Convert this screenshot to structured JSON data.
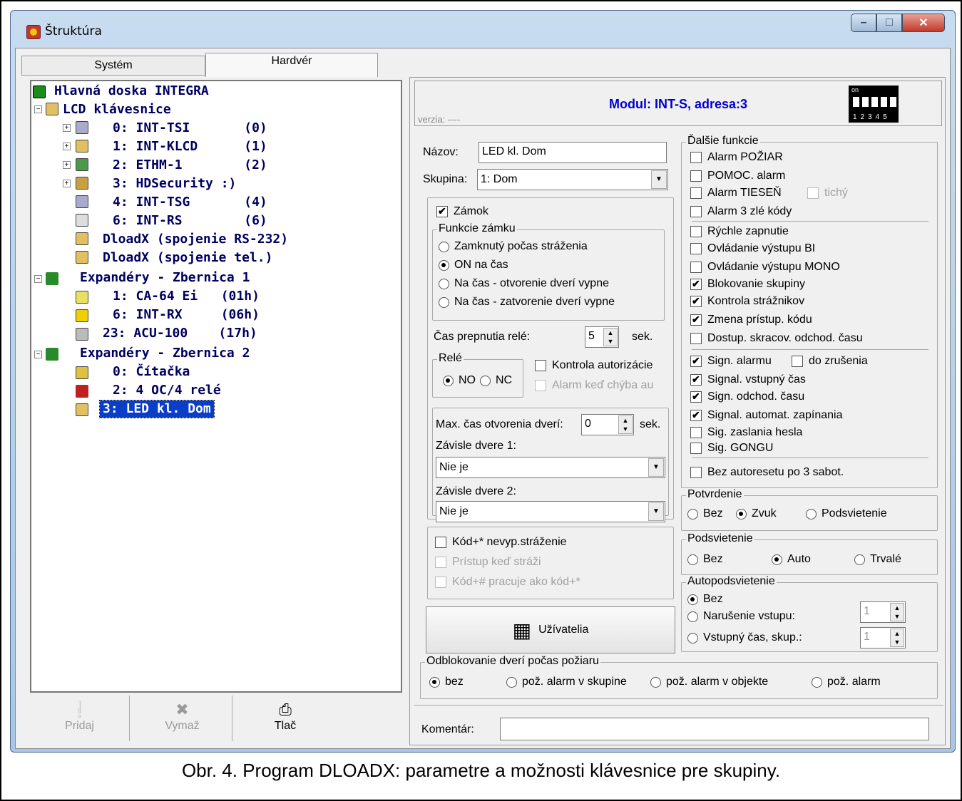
{
  "window": {
    "title": "Štruktúra",
    "min_label": "–",
    "max_label": "□",
    "close_label": "✕"
  },
  "tabs": [
    "Systém",
    "Hardvér"
  ],
  "tree": {
    "items": [
      "Hlavná doska INTEGRA",
      "LCD klávesnice",
      "0: INT-TSI       (0)",
      "1: INT-KLCD      (1)",
      "2: ETHM-1        (2)",
      "3: HDSecurity :)",
      "4: INT-TSG       (4)",
      "6: INT-RS        (6)",
      "DloadX (spojenie RS-232)",
      "DloadX (spojenie tel.)",
      "Expandéry - Zbernica 1",
      "1: CA-64 Ei   (01h)",
      "6: INT-RX     (06h)",
      "23: ACU-100    (17h)",
      "Expandéry - Zbernica 2",
      "0: Čítačka",
      "2: 4 OC/4 relé",
      "3: LED kl. Dom"
    ]
  },
  "toolbar": {
    "add": "Pridaj",
    "delete": "Vymaž",
    "print": "Tlač"
  },
  "module": {
    "title": "Modul: INT-S, adresa:3",
    "version": "verzia: ----",
    "dip_on": "on",
    "dip_nums": "12345"
  },
  "form": {
    "name_label": "Názov:",
    "name_value": "LED kl. Dom",
    "group_label": "Skupina:",
    "group_value": "1: Dom",
    "lock": "Zámok",
    "lock_functions": "Funkcie zámku",
    "lock_opts": [
      "Zamknutý počas stráženia",
      "ON na čas",
      "Na čas - otvorenie dverí vypne",
      "Na čas - zatvorenie dverí vypne"
    ],
    "relay_time_label": "Čas prepnutia relé:",
    "relay_time_value": "5",
    "sek": "sek.",
    "relay": "Relé",
    "no": "NO",
    "nc": "NC",
    "auth_control": "Kontrola autorizácie",
    "alarm_missing": "Alarm keď chýba au",
    "max_door_label": "Max. čas otvorenia dverí:",
    "max_door_value": "0",
    "dep_door1_label": "Závisle dvere 1:",
    "dep_door1_value": "Nie je",
    "dep_door2_label": "Závisle dvere 2:",
    "dep_door2_value": "Nie je",
    "code_star": "Kód+* nevyp.stráženie",
    "access_armed": "Prístup keď stráži",
    "code_hash": "Kód+# pracuje ako kód+*",
    "users_btn": "Užívatelia"
  },
  "more": {
    "title": "Ďalšie funkcie",
    "items": [
      "Alarm POŽIAR",
      "POMOC. alarm",
      "Alarm TIESEŇ",
      "Alarm 3 zlé kódy",
      "Rýchle zapnutie",
      "Ovládanie výstupu BI",
      "Ovládanie výstupu MONO",
      "Blokovanie skupiny",
      "Kontrola strážnikov",
      "Zmena prístup. kódu",
      "Dostup. skracov. odchod. času",
      "Sign. alarmu",
      "Signal. vstupný čas",
      "Sign. odchod. času",
      "Signal. automat. zapínania",
      "Sig. zaslania hesla",
      "Sig. GONGU",
      "Bez autoresetu po 3 sabot."
    ],
    "silent": "tichý",
    "until_cancel": "do zrušenia"
  },
  "confirm": {
    "title": "Potvrdenie",
    "opts": [
      "Bez",
      "Zvuk",
      "Podsvietenie"
    ]
  },
  "backlight": {
    "title": "Podsvietenie",
    "opts": [
      "Bez",
      "Auto",
      "Trvalé"
    ]
  },
  "autobacklight": {
    "title": "Autopodsvietenie",
    "opts": [
      "Bez",
      "Narušenie vstupu:",
      "Vstupný čas, skup.:"
    ],
    "v1": "1",
    "v2": "1"
  },
  "fire": {
    "title": "Odblokovanie dverí počas požiaru",
    "opts": [
      "bez",
      "pož. alarm v skupine",
      "pož. alarm v objekte",
      "pož. alarm"
    ]
  },
  "comment": {
    "label": "Komentár:",
    "value": ""
  },
  "caption": "Obr. 4. Program DLOADX: parametre a možnosti klávesnice pre skupiny."
}
